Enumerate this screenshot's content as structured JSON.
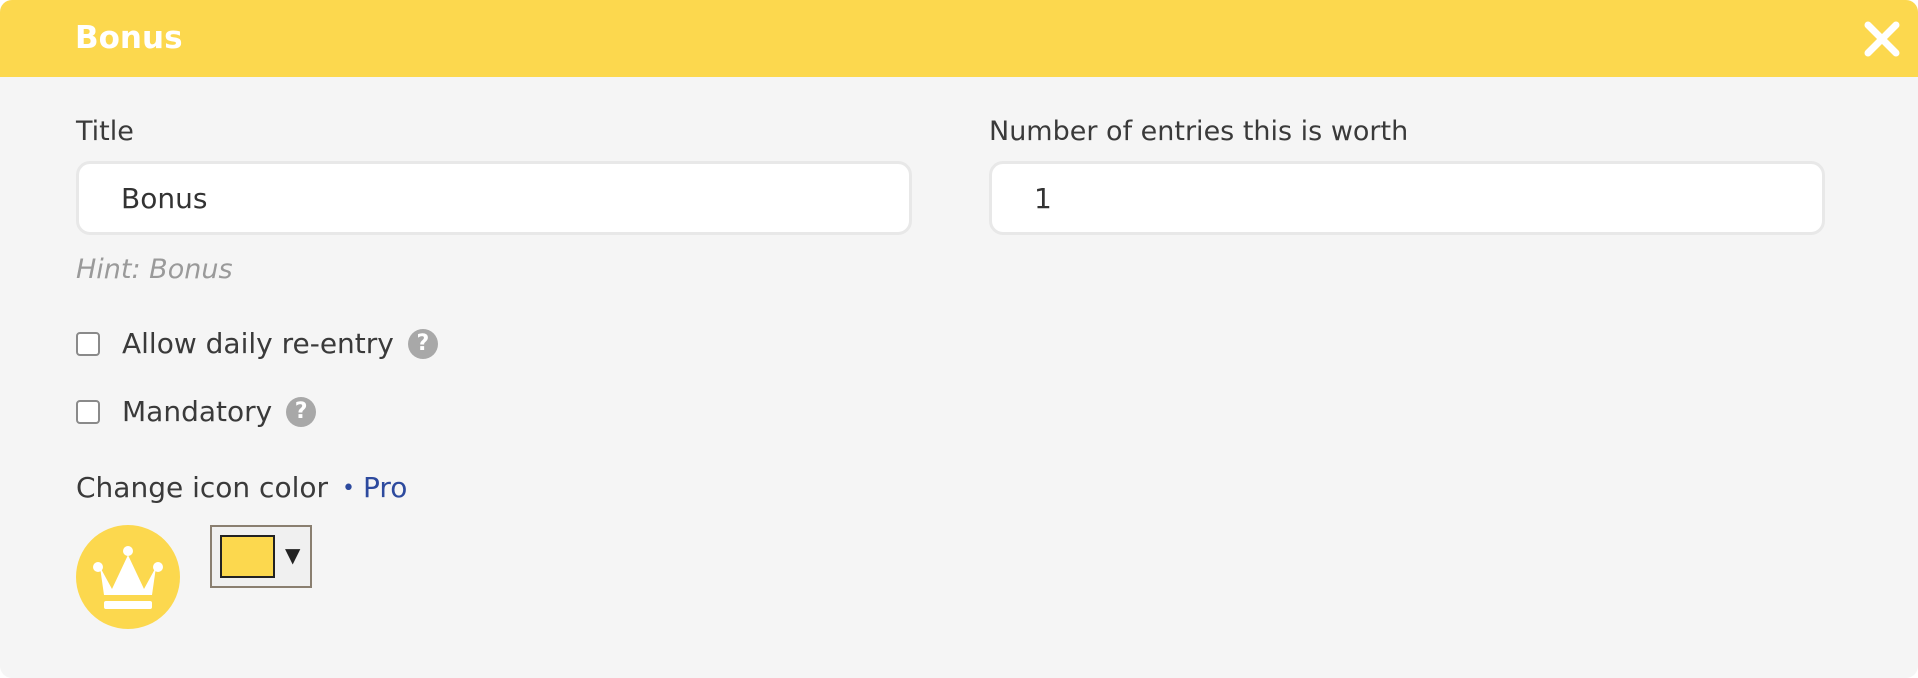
{
  "colors": {
    "accent": "#fcd84e"
  },
  "dialog": {
    "title": "Bonus",
    "close_icon": "close-icon"
  },
  "form": {
    "title_label": "Title",
    "title_value": "Bonus",
    "title_hint": "Hint: Bonus",
    "entries_label": "Number of entries this is worth",
    "entries_value": "1",
    "daily_reentry_label": "Allow daily re-entry",
    "mandatory_label": "Mandatory",
    "help_icon_glyph": "?",
    "change_icon_color_label": "Change icon color",
    "pro_bullet": "•",
    "pro_label": "Pro",
    "preview_icon": "crown-icon",
    "picker_arrow": "▼"
  }
}
